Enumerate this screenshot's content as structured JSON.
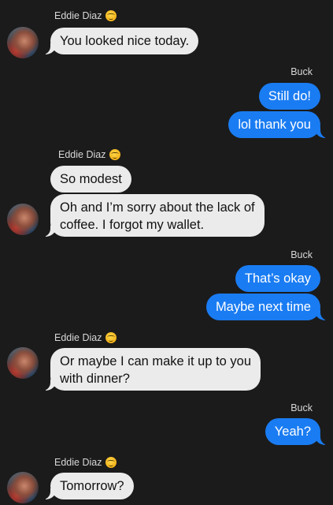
{
  "conversation": {
    "messages": [
      {
        "sender": "Eddie Diaz",
        "emoji": "relieved-face-icon",
        "text": "You looked nice today."
      },
      {
        "sender": "Buck",
        "text": "Still do!"
      },
      {
        "sender": "Buck",
        "text": "lol thank you"
      },
      {
        "sender": "Eddie Diaz",
        "emoji": "relieved-face-icon",
        "text": "So modest"
      },
      {
        "sender": "Eddie Diaz",
        "text": "Oh and I’m sorry about the lack of\ncoffee. I forgot my wallet."
      },
      {
        "sender": "Buck",
        "text": "That’s okay"
      },
      {
        "sender": "Buck",
        "text": "Maybe next time"
      },
      {
        "sender": "Eddie Diaz",
        "emoji": "relieved-face-icon",
        "text": "Or maybe I can make it up to you\nwith dinner?"
      },
      {
        "sender": "Buck",
        "text": "Yeah?"
      },
      {
        "sender": "Eddie Diaz",
        "emoji": "relieved-face-icon",
        "text": "Tomorrow?"
      }
    ]
  },
  "colors": {
    "background": "#1b1b1b",
    "incoming_bubble": "#ebebeb",
    "outgoing_bubble": "#1a7cf2"
  }
}
